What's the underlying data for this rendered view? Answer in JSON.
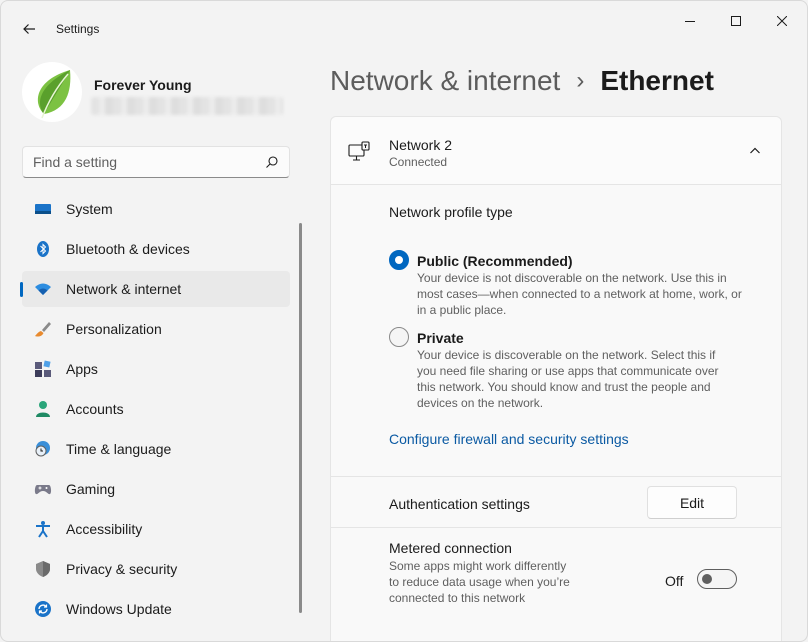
{
  "window": {
    "title": "Settings"
  },
  "profile": {
    "name": "Forever Young"
  },
  "search": {
    "placeholder": "Find a setting"
  },
  "sidebar": {
    "items": [
      {
        "label": "System",
        "icon": "monitor-icon",
        "selected": false
      },
      {
        "label": "Bluetooth & devices",
        "icon": "bluetooth-icon",
        "selected": false
      },
      {
        "label": "Network & internet",
        "icon": "wifi-icon",
        "selected": true
      },
      {
        "label": "Personalization",
        "icon": "brush-icon",
        "selected": false
      },
      {
        "label": "Apps",
        "icon": "apps-icon",
        "selected": false
      },
      {
        "label": "Accounts",
        "icon": "person-icon",
        "selected": false
      },
      {
        "label": "Time & language",
        "icon": "globe-clock-icon",
        "selected": false
      },
      {
        "label": "Gaming",
        "icon": "gamepad-icon",
        "selected": false
      },
      {
        "label": "Accessibility",
        "icon": "accessibility-icon",
        "selected": false
      },
      {
        "label": "Privacy & security",
        "icon": "shield-icon",
        "selected": false
      },
      {
        "label": "Windows Update",
        "icon": "update-icon",
        "selected": false
      }
    ]
  },
  "breadcrumb": {
    "parent": "Network & internet",
    "separator": "›",
    "current": "Ethernet"
  },
  "network": {
    "name": "Network 2",
    "status": "Connected"
  },
  "profile_type": {
    "label": "Network profile type",
    "options": [
      {
        "title": "Public (Recommended)",
        "description": "Your device is not discoverable on the network. Use this in most cases—when connected to a network at home, work, or in a public place.",
        "selected": true
      },
      {
        "title": "Private",
        "description": "Your device is discoverable on the network. Select this if you need file sharing or use apps that communicate over this network. You should know and trust the people and devices on the network.",
        "selected": false
      }
    ],
    "firewall_link": "Configure firewall and security settings"
  },
  "auth": {
    "label": "Authentication settings",
    "button": "Edit"
  },
  "metered": {
    "label": "Metered connection",
    "description": "Some apps might work differently to reduce data usage when you’re connected to this network",
    "state": "Off",
    "on": false
  },
  "colors": {
    "accent": "#0067c0",
    "link": "#0b5aa3",
    "background": "#f3f3f3"
  }
}
